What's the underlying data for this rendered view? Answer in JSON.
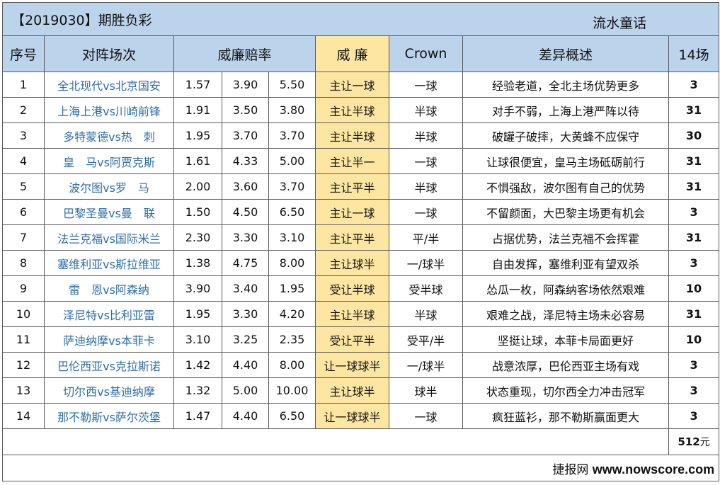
{
  "header": {
    "title": "【2019030】期胜负彩",
    "author": "流水童话"
  },
  "columns": {
    "no": "序号",
    "match": "对阵场次",
    "odds": "威廉赔率",
    "handicap": "威 廉",
    "crown": "Crown",
    "analysis": "差异概述",
    "votes": "14场"
  },
  "rows": [
    {
      "no": "1",
      "match": "全北现代vs北京国安",
      "o1": "1.57",
      "o2": "3.90",
      "o3": "5.50",
      "handicap": "主让一球",
      "crown": "一球",
      "analysis": "经验老道，全北主场优势更多",
      "pick": "3"
    },
    {
      "no": "2",
      "match": "上海上港vs川崎前锋",
      "o1": "1.91",
      "o2": "3.50",
      "o3": "3.80",
      "handicap": "主让半球",
      "crown": "半球",
      "analysis": "对手不弱，上海上港严阵以待",
      "pick": "31"
    },
    {
      "no": "3",
      "match": "多特蒙德vs热　刺",
      "o1": "1.95",
      "o2": "3.70",
      "o3": "3.70",
      "handicap": "主让半球",
      "crown": "半球",
      "analysis": "破罐子破摔，大黄蜂不应保守",
      "pick": "30"
    },
    {
      "no": "4",
      "match": "皇　马vs阿贾克斯",
      "o1": "1.61",
      "o2": "4.33",
      "o3": "5.00",
      "handicap": "主让半一",
      "crown": "一球",
      "analysis": "让球很便宜，皇马主场砥砺前行",
      "pick": "31"
    },
    {
      "no": "5",
      "match": "波尔图vs罗　马",
      "o1": "2.00",
      "o2": "3.60",
      "o3": "3.70",
      "handicap": "主让平半",
      "crown": "半球",
      "analysis": "不惧强敌，波尔图有自己的优势",
      "pick": "31"
    },
    {
      "no": "6",
      "match": "巴黎圣曼vs曼　联",
      "o1": "1.50",
      "o2": "4.50",
      "o3": "6.50",
      "handicap": "主让一球",
      "crown": "一球",
      "analysis": "不留颜面，大巴黎主场更有机会",
      "pick": "3"
    },
    {
      "no": "7",
      "match": "法兰克福vs国际米兰",
      "o1": "2.30",
      "o2": "3.30",
      "o3": "3.10",
      "handicap": "主让平半",
      "crown": "平/半",
      "analysis": "占据优势，法兰克福不会挥霍",
      "pick": "31"
    },
    {
      "no": "8",
      "match": "塞维利亚vs斯拉维亚",
      "o1": "1.38",
      "o2": "4.75",
      "o3": "8.00",
      "handicap": "主让球半",
      "crown": "一/球半",
      "analysis": "自由发挥，塞维利亚有望双杀",
      "pick": "3"
    },
    {
      "no": "9",
      "match": "雷　恩vs阿森纳",
      "o1": "3.90",
      "o2": "3.40",
      "o3": "1.95",
      "handicap": "受让半球",
      "crown": "受半球",
      "analysis": "怂瓜一枚，阿森纳客场依然艰难",
      "pick": "10"
    },
    {
      "no": "10",
      "match": "泽尼特vs比利亚雷",
      "o1": "1.95",
      "o2": "3.30",
      "o3": "4.20",
      "handicap": "主让半球",
      "crown": "半球",
      "analysis": "艰难之战，泽尼特主场未必容易",
      "pick": "31"
    },
    {
      "no": "11",
      "match": "萨迪纳摩vs本菲卡",
      "o1": "3.10",
      "o2": "3.25",
      "o3": "2.35",
      "handicap": "受让平半",
      "crown": "受平/半",
      "analysis": "坚挺让球，本菲卡局面更好",
      "pick": "10"
    },
    {
      "no": "12",
      "match": "巴伦西亚vs克拉斯诺",
      "o1": "1.42",
      "o2": "4.40",
      "o3": "8.00",
      "handicap": "让一球球半",
      "crown": "一/球半",
      "analysis": "战意浓厚，巴伦西亚主场有戏",
      "pick": "3"
    },
    {
      "no": "13",
      "match": "切尔西vs基迪纳摩",
      "o1": "1.32",
      "o2": "5.00",
      "o3": "10.00",
      "handicap": "主让球半",
      "crown": "球半",
      "analysis": "状态重现，切尔西全力冲击冠军",
      "pick": "3"
    },
    {
      "no": "14",
      "match": "那不勒斯vs萨尔茨堡",
      "o1": "1.47",
      "o2": "4.40",
      "o3": "6.50",
      "handicap": "让一球球半",
      "crown": "一球",
      "analysis": "疯狂蓝衫，那不勒斯赢面更大",
      "pick": "3"
    }
  ],
  "total": {
    "value": "512",
    "unit": "元"
  },
  "footer": {
    "label": "捷报网",
    "site": "www.nowscore.com"
  },
  "colors": {
    "header_bg": "#bcd3ec",
    "handicap_highlight": "#fde6a2",
    "team_text": "#2e6ea8"
  }
}
